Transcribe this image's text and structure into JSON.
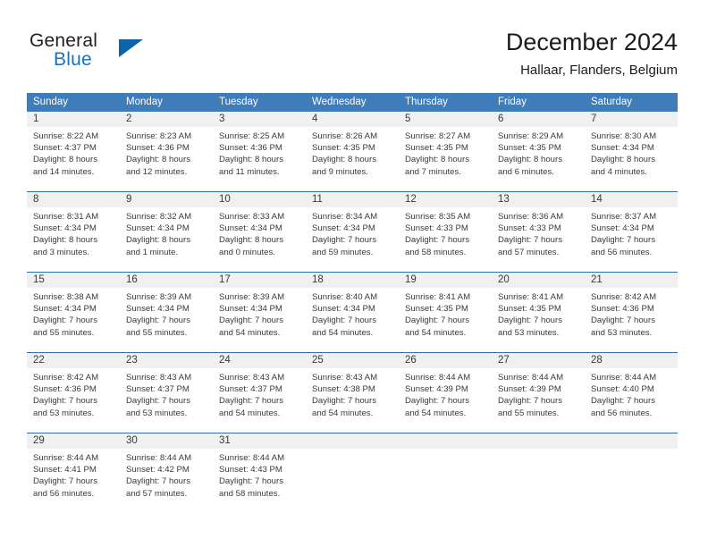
{
  "brand": {
    "name_part1": "General",
    "name_part2": "Blue",
    "triangle_color": "#0d63a8",
    "blue_color": "#1a72b8"
  },
  "header": {
    "title": "December 2024",
    "subtitle": "Hallaar, Flanders, Belgium"
  },
  "calendar": {
    "header_bg": "#3f7cba",
    "row_separator_color": "#2e6fae",
    "daynum_band_bg": "#f0f0f0",
    "weekdays": [
      "Sunday",
      "Monday",
      "Tuesday",
      "Wednesday",
      "Thursday",
      "Friday",
      "Saturday"
    ],
    "weeks": [
      {
        "days": [
          {
            "num": "1",
            "sunrise": "Sunrise: 8:22 AM",
            "sunset": "Sunset: 4:37 PM",
            "daylight1": "Daylight: 8 hours",
            "daylight2": "and 14 minutes."
          },
          {
            "num": "2",
            "sunrise": "Sunrise: 8:23 AM",
            "sunset": "Sunset: 4:36 PM",
            "daylight1": "Daylight: 8 hours",
            "daylight2": "and 12 minutes."
          },
          {
            "num": "3",
            "sunrise": "Sunrise: 8:25 AM",
            "sunset": "Sunset: 4:36 PM",
            "daylight1": "Daylight: 8 hours",
            "daylight2": "and 11 minutes."
          },
          {
            "num": "4",
            "sunrise": "Sunrise: 8:26 AM",
            "sunset": "Sunset: 4:35 PM",
            "daylight1": "Daylight: 8 hours",
            "daylight2": "and 9 minutes."
          },
          {
            "num": "5",
            "sunrise": "Sunrise: 8:27 AM",
            "sunset": "Sunset: 4:35 PM",
            "daylight1": "Daylight: 8 hours",
            "daylight2": "and 7 minutes."
          },
          {
            "num": "6",
            "sunrise": "Sunrise: 8:29 AM",
            "sunset": "Sunset: 4:35 PM",
            "daylight1": "Daylight: 8 hours",
            "daylight2": "and 6 minutes."
          },
          {
            "num": "7",
            "sunrise": "Sunrise: 8:30 AM",
            "sunset": "Sunset: 4:34 PM",
            "daylight1": "Daylight: 8 hours",
            "daylight2": "and 4 minutes."
          }
        ]
      },
      {
        "days": [
          {
            "num": "8",
            "sunrise": "Sunrise: 8:31 AM",
            "sunset": "Sunset: 4:34 PM",
            "daylight1": "Daylight: 8 hours",
            "daylight2": "and 3 minutes."
          },
          {
            "num": "9",
            "sunrise": "Sunrise: 8:32 AM",
            "sunset": "Sunset: 4:34 PM",
            "daylight1": "Daylight: 8 hours",
            "daylight2": "and 1 minute."
          },
          {
            "num": "10",
            "sunrise": "Sunrise: 8:33 AM",
            "sunset": "Sunset: 4:34 PM",
            "daylight1": "Daylight: 8 hours",
            "daylight2": "and 0 minutes."
          },
          {
            "num": "11",
            "sunrise": "Sunrise: 8:34 AM",
            "sunset": "Sunset: 4:34 PM",
            "daylight1": "Daylight: 7 hours",
            "daylight2": "and 59 minutes."
          },
          {
            "num": "12",
            "sunrise": "Sunrise: 8:35 AM",
            "sunset": "Sunset: 4:33 PM",
            "daylight1": "Daylight: 7 hours",
            "daylight2": "and 58 minutes."
          },
          {
            "num": "13",
            "sunrise": "Sunrise: 8:36 AM",
            "sunset": "Sunset: 4:33 PM",
            "daylight1": "Daylight: 7 hours",
            "daylight2": "and 57 minutes."
          },
          {
            "num": "14",
            "sunrise": "Sunrise: 8:37 AM",
            "sunset": "Sunset: 4:34 PM",
            "daylight1": "Daylight: 7 hours",
            "daylight2": "and 56 minutes."
          }
        ]
      },
      {
        "days": [
          {
            "num": "15",
            "sunrise": "Sunrise: 8:38 AM",
            "sunset": "Sunset: 4:34 PM",
            "daylight1": "Daylight: 7 hours",
            "daylight2": "and 55 minutes."
          },
          {
            "num": "16",
            "sunrise": "Sunrise: 8:39 AM",
            "sunset": "Sunset: 4:34 PM",
            "daylight1": "Daylight: 7 hours",
            "daylight2": "and 55 minutes."
          },
          {
            "num": "17",
            "sunrise": "Sunrise: 8:39 AM",
            "sunset": "Sunset: 4:34 PM",
            "daylight1": "Daylight: 7 hours",
            "daylight2": "and 54 minutes."
          },
          {
            "num": "18",
            "sunrise": "Sunrise: 8:40 AM",
            "sunset": "Sunset: 4:34 PM",
            "daylight1": "Daylight: 7 hours",
            "daylight2": "and 54 minutes."
          },
          {
            "num": "19",
            "sunrise": "Sunrise: 8:41 AM",
            "sunset": "Sunset: 4:35 PM",
            "daylight1": "Daylight: 7 hours",
            "daylight2": "and 54 minutes."
          },
          {
            "num": "20",
            "sunrise": "Sunrise: 8:41 AM",
            "sunset": "Sunset: 4:35 PM",
            "daylight1": "Daylight: 7 hours",
            "daylight2": "and 53 minutes."
          },
          {
            "num": "21",
            "sunrise": "Sunrise: 8:42 AM",
            "sunset": "Sunset: 4:36 PM",
            "daylight1": "Daylight: 7 hours",
            "daylight2": "and 53 minutes."
          }
        ]
      },
      {
        "days": [
          {
            "num": "22",
            "sunrise": "Sunrise: 8:42 AM",
            "sunset": "Sunset: 4:36 PM",
            "daylight1": "Daylight: 7 hours",
            "daylight2": "and 53 minutes."
          },
          {
            "num": "23",
            "sunrise": "Sunrise: 8:43 AM",
            "sunset": "Sunset: 4:37 PM",
            "daylight1": "Daylight: 7 hours",
            "daylight2": "and 53 minutes."
          },
          {
            "num": "24",
            "sunrise": "Sunrise: 8:43 AM",
            "sunset": "Sunset: 4:37 PM",
            "daylight1": "Daylight: 7 hours",
            "daylight2": "and 54 minutes."
          },
          {
            "num": "25",
            "sunrise": "Sunrise: 8:43 AM",
            "sunset": "Sunset: 4:38 PM",
            "daylight1": "Daylight: 7 hours",
            "daylight2": "and 54 minutes."
          },
          {
            "num": "26",
            "sunrise": "Sunrise: 8:44 AM",
            "sunset": "Sunset: 4:39 PM",
            "daylight1": "Daylight: 7 hours",
            "daylight2": "and 54 minutes."
          },
          {
            "num": "27",
            "sunrise": "Sunrise: 8:44 AM",
            "sunset": "Sunset: 4:39 PM",
            "daylight1": "Daylight: 7 hours",
            "daylight2": "and 55 minutes."
          },
          {
            "num": "28",
            "sunrise": "Sunrise: 8:44 AM",
            "sunset": "Sunset: 4:40 PM",
            "daylight1": "Daylight: 7 hours",
            "daylight2": "and 56 minutes."
          }
        ]
      },
      {
        "days": [
          {
            "num": "29",
            "sunrise": "Sunrise: 8:44 AM",
            "sunset": "Sunset: 4:41 PM",
            "daylight1": "Daylight: 7 hours",
            "daylight2": "and 56 minutes."
          },
          {
            "num": "30",
            "sunrise": "Sunrise: 8:44 AM",
            "sunset": "Sunset: 4:42 PM",
            "daylight1": "Daylight: 7 hours",
            "daylight2": "and 57 minutes."
          },
          {
            "num": "31",
            "sunrise": "Sunrise: 8:44 AM",
            "sunset": "Sunset: 4:43 PM",
            "daylight1": "Daylight: 7 hours",
            "daylight2": "and 58 minutes."
          },
          {
            "num": "",
            "sunrise": "",
            "sunset": "",
            "daylight1": "",
            "daylight2": ""
          },
          {
            "num": "",
            "sunrise": "",
            "sunset": "",
            "daylight1": "",
            "daylight2": ""
          },
          {
            "num": "",
            "sunrise": "",
            "sunset": "",
            "daylight1": "",
            "daylight2": ""
          },
          {
            "num": "",
            "sunrise": "",
            "sunset": "",
            "daylight1": "",
            "daylight2": ""
          }
        ]
      }
    ]
  }
}
